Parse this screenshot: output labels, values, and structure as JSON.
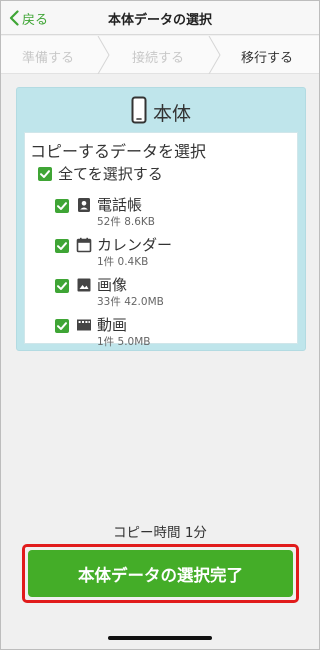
{
  "nav": {
    "back_label": "戻る",
    "title": "本体データの選択"
  },
  "steps": [
    {
      "label": "準備する",
      "state": "done"
    },
    {
      "label": "接続する",
      "state": "done"
    },
    {
      "label": "移行する",
      "state": "current"
    }
  ],
  "panel": {
    "title": "本体",
    "section_title": "コピーするデータを選択",
    "select_all_label": "全てを選択する",
    "select_all_checked": true,
    "items": [
      {
        "icon": "contacts-icon",
        "label": "電話帳",
        "detail": "52件 8.6KB",
        "checked": true
      },
      {
        "icon": "calendar-icon",
        "label": "カレンダー",
        "detail": "1件 0.4KB",
        "checked": true
      },
      {
        "icon": "image-icon",
        "label": "画像",
        "detail": "33件 42.0MB",
        "checked": true
      },
      {
        "icon": "video-icon",
        "label": "動画",
        "detail": "1件 5.0MB",
        "checked": true
      }
    ]
  },
  "copy_time": "コピー時間 1分",
  "primary_button": "本体データの選択完了",
  "colors": {
    "accent": "#3fa535",
    "panel_bg": "#bfe5eb",
    "button_bg": "#44ad28",
    "highlight_border": "#e11b1b"
  }
}
